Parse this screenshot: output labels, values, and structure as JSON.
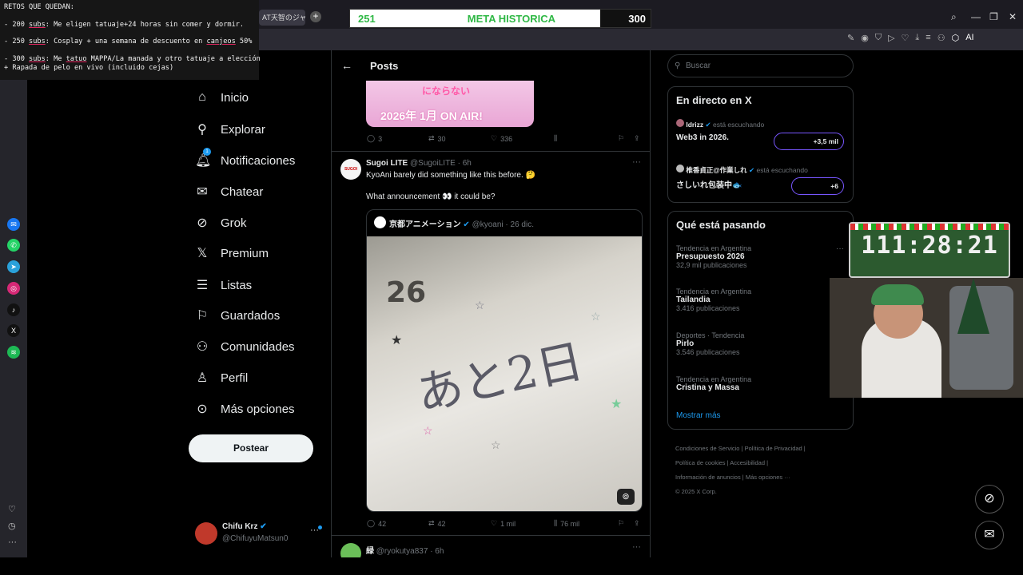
{
  "browser": {
    "tab_label": "AT天智のジャ",
    "new_tab_symbol": "+",
    "ai_label": "AI"
  },
  "goals": {
    "heading": "RETOS QUE QUEDAN:",
    "items": [
      {
        "count": "- 200 ",
        "subs": "subs",
        "text": ": Me eligen tatuaje+24 horas sin comer y dormir."
      },
      {
        "count": "- 250 ",
        "subs": "subs",
        "text": ": Cosplay + una semana de descuento en ",
        "extra": "canjeos",
        "tail": " 50%"
      },
      {
        "count": "- 300 ",
        "subs": "subs",
        "text": ": Me ",
        "extra": "tatuo",
        "tail": " MAPPA/La manada y otro tatuaje a elección"
      }
    ],
    "line4": "+ Rapada de pelo en vivo (incluido cejas)"
  },
  "meta": {
    "current": "251",
    "title": "META HISTORICA",
    "target": "300",
    "progress": 0.0
  },
  "nav": {
    "items": [
      {
        "label": "Inicio",
        "icon": "home-icon"
      },
      {
        "label": "Explorar",
        "icon": "search-icon"
      },
      {
        "label": "Notificaciones",
        "icon": "bell-icon",
        "badge": "1"
      },
      {
        "label": "Chatear",
        "icon": "mail-icon"
      },
      {
        "label": "Grok",
        "icon": "grok-icon"
      },
      {
        "label": "Premium",
        "icon": "x-logo-icon"
      },
      {
        "label": "Listas",
        "icon": "list-icon"
      },
      {
        "label": "Guardados",
        "icon": "bookmark-icon"
      },
      {
        "label": "Comunidades",
        "icon": "people-icon"
      },
      {
        "label": "Perfil",
        "icon": "person-icon"
      },
      {
        "label": "Más opciones",
        "icon": "more-circle-icon"
      }
    ],
    "post_button": "Postear"
  },
  "profile": {
    "name": "Chifu Krz",
    "handle": "@ChifuyuMatsun0",
    "more": "···"
  },
  "feed": {
    "title": "Posts",
    "prev_image_text_1": "にならない",
    "prev_image_text_2": "2026年 1月 ON AIR!",
    "prev_stats": {
      "replies": "3",
      "reposts": "30",
      "likes": "336"
    },
    "tweet": {
      "name": "Sugoi LITE",
      "handle": "@SugoiLITE · 6h",
      "avatar_text": "SUGOI",
      "line1": "KyoAni barely did something like this before. 🤔",
      "line2": "What announcement 👀 it could be?",
      "quote_name": "京都アニメーション",
      "quote_handle": "@kyoani · 26 dic.",
      "image_number": "26",
      "image_text": "あと2日",
      "stats": {
        "replies": "42",
        "reposts": "42",
        "likes": "1 mil",
        "views": "76 mil"
      }
    },
    "next_tweet": {
      "name": "緑",
      "handle": "@ryokutya837 · 6h"
    }
  },
  "right": {
    "search_placeholder": "Buscar",
    "live_title": "En directo en X",
    "live": [
      {
        "user": "Idrizz",
        "status": "está escuchando",
        "title": "Web3 in 2026.",
        "count": "+3,5 mil"
      },
      {
        "user": "椎香貞正@作業しれ",
        "status": "está escuchando",
        "title": "さしいれ包装中🐟",
        "count": "+6"
      }
    ],
    "trends_title": "Qué está pasando",
    "trends": [
      {
        "category": "Tendencia en Argentina",
        "name": "Presupuesto 2026",
        "posts": "32,9 mil publicaciones"
      },
      {
        "category": "Tendencia en Argentina",
        "name": "Tailandia",
        "posts": "3.416 publicaciones"
      },
      {
        "category": "Deportes · Tendencia",
        "name": "Pirlo",
        "posts": "3.546 publicaciones"
      },
      {
        "category": "Tendencia en Argentina",
        "name": "Cristina y Massa",
        "posts": ""
      }
    ],
    "show_more": "Mostrar más",
    "footer": {
      "l1a": "Condiciones de Servicio",
      "l1b": "Política de Privacidad",
      "l2a": "Política de cookies",
      "l2b": "Accesibilidad",
      "l3a": "Información de anuncios",
      "l3b": "Más opciones ···",
      "copyright": "© 2025 X Corp."
    }
  },
  "timer": {
    "value": "111:28:21"
  }
}
